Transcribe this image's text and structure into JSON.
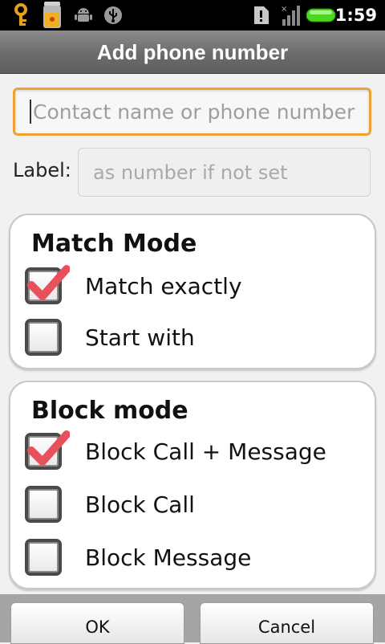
{
  "status_bar": {
    "time": "1:59",
    "icons": [
      "key-icon",
      "lock-battery-icon",
      "android-icon",
      "usb-icon",
      "alert-icon",
      "signal-icon",
      "battery-icon"
    ]
  },
  "dialog": {
    "title": "Add phone number",
    "contact_input": {
      "placeholder": "Contact name or phone number",
      "value": ""
    },
    "label": {
      "text": "Label:",
      "placeholder": "as number if not set",
      "value": ""
    },
    "match_mode": {
      "title": "Match Mode",
      "options": [
        {
          "label": "Match exactly",
          "checked": true
        },
        {
          "label": "Start with",
          "checked": false
        }
      ]
    },
    "block_mode": {
      "title": "Block mode",
      "options": [
        {
          "label": "Block Call + Message",
          "checked": true
        },
        {
          "label": "Block Call",
          "checked": false
        },
        {
          "label": "Block Message",
          "checked": false
        }
      ]
    },
    "buttons": {
      "ok": "OK",
      "cancel": "Cancel"
    }
  },
  "colors": {
    "accent_focus": "#f0a035",
    "checkmark": "#e8505b",
    "battery": "#4ad820"
  }
}
